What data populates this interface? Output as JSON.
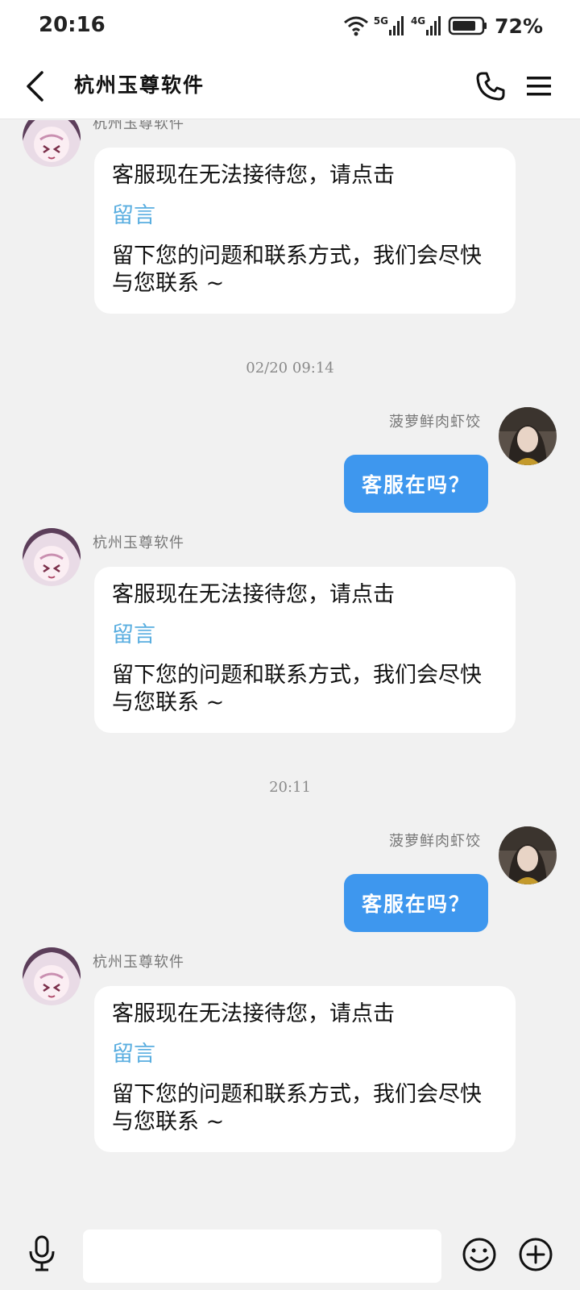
{
  "status_bar": {
    "time": "20:16",
    "network_5g": "5G",
    "network_4g": "4G",
    "battery": "72%"
  },
  "header": {
    "title": "杭州玉尊软件"
  },
  "messages": [
    {
      "sender": "杭州玉尊软件",
      "line1": "客服现在无法接待您，请点击",
      "link": "留言",
      "line2": "留下您的问题和联系方式，我们会尽快",
      "line3": "与您联系 ~"
    },
    {
      "timestamp": "02/20 09:14",
      "sender": "菠萝鲜肉虾饺",
      "text": "客服在吗？"
    },
    {
      "sender": "杭州玉尊软件",
      "line1": "客服现在无法接待您，请点击",
      "link": "留言",
      "line2": "留下您的问题和联系方式，我们会尽快",
      "line3": "与您联系 ~"
    },
    {
      "timestamp": "20:11",
      "sender": "菠萝鲜肉虾饺",
      "text": "客服在吗？"
    },
    {
      "sender": "杭州玉尊软件",
      "line1": "客服现在无法接待您，请点击",
      "link": "留言",
      "line2": "留下您的问题和联系方式，我们会尽快",
      "line3": "与您联系 ~"
    }
  ],
  "input_bar": {
    "placeholder": ""
  },
  "colors": {
    "page_bg": "#f1f1f1",
    "user_bubble": "#3e97ee",
    "link": "#5aaee0"
  },
  "icons": [
    "back-arrow-icon",
    "phone-icon",
    "menu-icon",
    "microphone-icon",
    "emoji-icon",
    "plus-icon",
    "wifi-icon",
    "signal-icon",
    "battery-icon"
  ]
}
